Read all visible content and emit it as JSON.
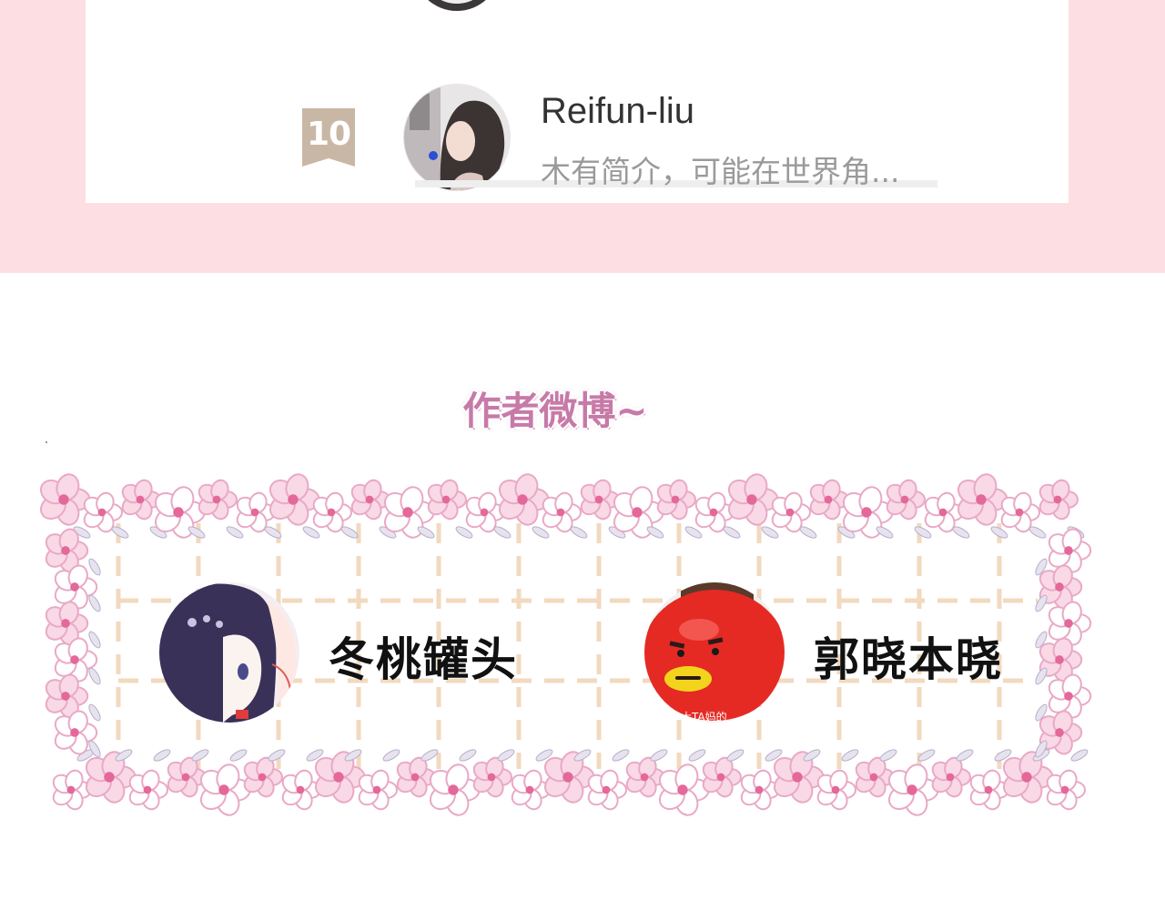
{
  "ranking": {
    "entry": {
      "rank": "10",
      "username": "Reifun-liu",
      "bio": "木有简介，可能在世界角..."
    }
  },
  "weibo_section": {
    "title": "作者微博~",
    "authors": [
      {
        "name": "冬桃罐头",
        "avatar_caption": ""
      },
      {
        "name": "郭晓本晓",
        "avatar_caption": "大TA妈的"
      }
    ]
  },
  "colors": {
    "page_pink": "#fddfe3",
    "badge": "#c9b7a5",
    "title_pink": "#c77aa8",
    "flower_pink": "#e9a9c6",
    "grid_dash": "#f2d9bf"
  }
}
